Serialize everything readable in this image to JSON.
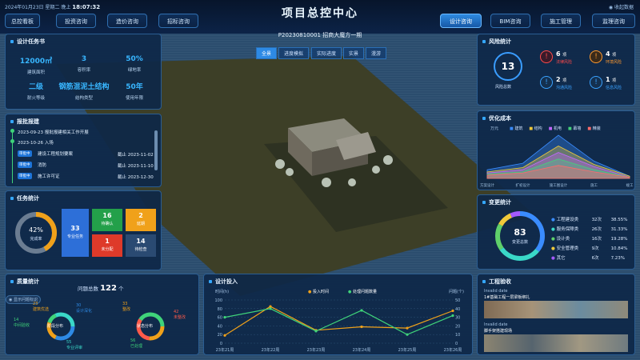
{
  "header": {
    "date": "2024年01月23日 星期二 晚上",
    "time": "18:07:32",
    "title": "项目总控中心",
    "right": "收起数据",
    "nav_left": [
      "总控看板",
      "投资咨询",
      "造价咨询",
      "招标咨询"
    ],
    "nav_right": [
      "设计咨询",
      "BIM咨询",
      "施工管理",
      "监理咨询"
    ]
  },
  "design": {
    "title": "设计任务书",
    "stats": [
      {
        "v": "12000㎡",
        "l": "建筑面积"
      },
      {
        "v": "3",
        "l": "容积率"
      },
      {
        "v": "50%",
        "l": "绿地率"
      },
      {
        "v": "二级",
        "l": "耐火等级"
      },
      {
        "v": "钢筋混泥土结构",
        "l": "结构类型"
      },
      {
        "v": "50年",
        "l": "使用年限"
      }
    ]
  },
  "report": {
    "title": "报批报建",
    "items": [
      {
        "text": "2023-09-23 报批报建相关工作开展",
        "date": "",
        "tag": ""
      },
      {
        "text": "2023-10-26 入场",
        "date": "",
        "tag": ""
      },
      {
        "text": "建设工程规划要案",
        "date": "截止 2023-11-02",
        "tag": "审批中"
      },
      {
        "text": "消防",
        "date": "截止 2023-11-10",
        "tag": "审批中"
      },
      {
        "text": "施工许可证",
        "date": "截止 2023-12-30",
        "tag": "审批中"
      }
    ]
  },
  "tasks": {
    "title": "任务统计",
    "percent": "42%",
    "percent_label": "完成率",
    "percent_value": 0.42,
    "boxes": [
      {
        "n": "33",
        "t": "专业任务",
        "c": "#2d6fd8"
      },
      {
        "n": "16",
        "t": "待确认",
        "c": "#23a04a"
      },
      {
        "n": "2",
        "t": "延期",
        "c": "#f0a11a"
      },
      {
        "n": "1",
        "t": "未分配",
        "c": "#de3a2a"
      },
      {
        "n": "14",
        "t": "待检查",
        "c": "#2a4a72"
      }
    ]
  },
  "quality": {
    "title": "质量统计",
    "total_label": "问题总数",
    "total": "122",
    "unit": "个",
    "toggle": "显示问题标识",
    "donut1": {
      "center": "阶段分布",
      "labels": [
        {
          "v": "23",
          "t": "建筑优选"
        },
        {
          "v": "30",
          "t": "设计深化"
        },
        {
          "v": "14",
          "t": "中间验收"
        },
        {
          "v": "55",
          "t": "专业评审"
        }
      ]
    },
    "donut2": {
      "center": "状态分布",
      "labels": [
        {
          "v": "33",
          "t": "整改"
        },
        {
          "v": "42",
          "t": "未整改"
        },
        {
          "v": "56",
          "t": "已处理"
        }
      ]
    }
  },
  "center": {
    "project": "P20230810001 招商大魔方一期",
    "tabs": [
      "全景",
      "进度模拟",
      "实际进度",
      "实景",
      "漫游"
    ],
    "active_tab": 0
  },
  "design_input": {
    "title": "设计投入",
    "y_left": "时间(h)",
    "y_right": "问题(个)",
    "legend": [
      "投入时间",
      "处理问题数量"
    ]
  },
  "risk": {
    "title": "风险统计",
    "total": "13",
    "total_label": "风险总数",
    "items": [
      {
        "v": "6",
        "u": "项",
        "t": "法律风险",
        "c": "#ff4a4a"
      },
      {
        "v": "4",
        "u": "项",
        "t": "环境风险",
        "c": "#ff9a2f"
      },
      {
        "v": "2",
        "u": "项",
        "t": "沟通风险",
        "c": "#3aa2ff"
      },
      {
        "v": "1",
        "u": "项",
        "t": "信息风险",
        "c": "#3aa2ff"
      }
    ]
  },
  "cost": {
    "title": "优化成本",
    "yl": "万元",
    "legend": [
      "建筑",
      "结构",
      "机电",
      "幕墙",
      "精装"
    ],
    "legend_colors": [
      "#3a8cff",
      "#f0c93a",
      "#c266ff",
      "#45d17a",
      "#ff6b6b"
    ],
    "x": [
      "方案设计",
      "扩初设计",
      "施工图设计",
      "施工",
      "竣工"
    ]
  },
  "change": {
    "title": "变更统计",
    "total": "83",
    "total_label": "变更总数",
    "rows": [
      {
        "n": "工程建设类",
        "c": "32次",
        "p": "38.55%",
        "col": "#3a8cff"
      },
      {
        "n": "服务保障类",
        "c": "26次",
        "p": "31.33%",
        "col": "#3ad8c8"
      },
      {
        "n": "设计类",
        "c": "16次",
        "p": "19.28%",
        "col": "#5fd06a"
      },
      {
        "n": "安全管理类",
        "c": "9次",
        "p": "10.84%",
        "col": "#f0c93a"
      },
      {
        "n": "其它",
        "c": "6次",
        "p": "7.23%",
        "col": "#a55aff"
      }
    ]
  },
  "acceptance": {
    "title": "工程验收",
    "items": [
      {
        "d": "Invalid date",
        "t": "1#基础工程一层梁板绑扎",
        "d2": "Invalid date",
        "t2": "脚手架搭建现场"
      }
    ]
  },
  "chart_data": [
    {
      "type": "line",
      "title": "设计投入",
      "categories": [
        "23年21周",
        "23年22周",
        "23年23周",
        "23年24周",
        "23年25周",
        "23年26周"
      ],
      "ylabel": "时间(h)",
      "y2label": "问题(个)",
      "ylim": [
        0,
        100
      ],
      "y2lim": [
        0,
        50
      ],
      "series": [
        {
          "name": "投入时间",
          "axis": "left",
          "values": [
            18,
            85,
            30,
            38,
            35,
            75
          ]
        },
        {
          "name": "处理问题数量",
          "axis": "right",
          "values": [
            30,
            40,
            14,
            38,
            10,
            32
          ]
        }
      ]
    },
    {
      "type": "area",
      "title": "优化成本",
      "categories": [
        "方案设计",
        "扩初设计",
        "施工图设计",
        "施工",
        "竣工"
      ],
      "ylabel": "万元",
      "series": [
        {
          "name": "建筑",
          "values": [
            8,
            14,
            40,
            16,
            2
          ]
        },
        {
          "name": "结构",
          "values": [
            6,
            10,
            30,
            13,
            2
          ]
        },
        {
          "name": "机电",
          "values": [
            5,
            8,
            24,
            11,
            1
          ]
        },
        {
          "name": "幕墙",
          "values": [
            4,
            6,
            18,
            8,
            1
          ]
        },
        {
          "name": "精装",
          "values": [
            3,
            5,
            12,
            6,
            1
          ]
        }
      ]
    },
    {
      "type": "pie",
      "title": "变更统计",
      "categories": [
        "工程建设类",
        "服务保障类",
        "设计类",
        "安全管理类",
        "其它"
      ],
      "values": [
        32,
        26,
        16,
        9,
        6
      ]
    }
  ]
}
